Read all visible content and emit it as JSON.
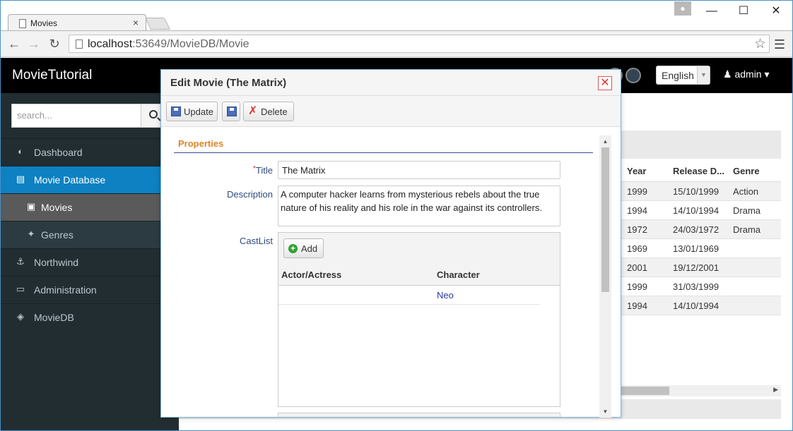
{
  "browser": {
    "tab_title": "Movies",
    "url_host": "localhost",
    "url_rest": ":53649/MovieDB/Movie",
    "tab_close": "×",
    "minimize": "—",
    "maximize": "☐",
    "close": "✕"
  },
  "app": {
    "brand": "MovieTutorial",
    "language": "English",
    "user": "admin"
  },
  "sidebar": {
    "search_placeholder": "search...",
    "items": [
      {
        "label": "Dashboard",
        "icon": "dashboard-icon"
      },
      {
        "label": "Movie Database",
        "icon": "film-icon"
      },
      {
        "label": "Movies",
        "icon": "movie-icon"
      },
      {
        "label": "Genres",
        "icon": "pin-icon"
      },
      {
        "label": "Northwind",
        "icon": "anchor-icon"
      },
      {
        "label": "Administration",
        "icon": "desktop-icon"
      },
      {
        "label": "MovieDB",
        "icon": "layers-icon"
      }
    ]
  },
  "grid": {
    "columns": [
      "Year",
      "Release D...",
      "Genre"
    ],
    "rows": [
      {
        "year": "1999",
        "release": "15/10/1999",
        "genre": "Action"
      },
      {
        "year": "1994",
        "release": "14/10/1994",
        "genre": "Drama"
      },
      {
        "year": "1972",
        "release": "24/03/1972",
        "genre": "Drama"
      },
      {
        "year": "1969",
        "release": "13/01/1969",
        "genre": ""
      },
      {
        "year": "2001",
        "release": "19/12/2001",
        "genre": ""
      },
      {
        "year": "1999",
        "release": "31/03/1999",
        "genre": ""
      },
      {
        "year": "1994",
        "release": "14/10/1994",
        "genre": ""
      }
    ]
  },
  "dialog": {
    "title": "Edit Movie (The Matrix)",
    "update_label": "Update",
    "delete_label": "Delete",
    "section": "Properties",
    "title_label": "Title",
    "title_value": "The Matrix",
    "description_label": "Description",
    "description_value": "A computer hacker learns from mysterious rebels about the true nature of his reality and his role in the war against its controllers.",
    "castlist_label": "CastList",
    "add_label": "Add",
    "cast_columns": [
      "Actor/Actress",
      "Character"
    ],
    "cast_rows": [
      {
        "actor": "",
        "character": "Neo"
      }
    ]
  }
}
